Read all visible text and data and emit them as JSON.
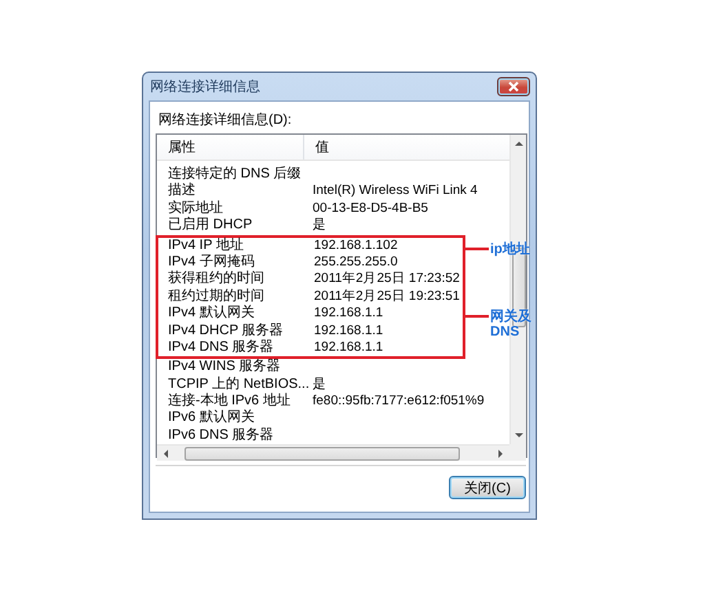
{
  "window": {
    "title": "网络连接详细信息"
  },
  "list_label": "网络连接详细信息(D):",
  "table": {
    "columns": [
      "属性",
      "值"
    ],
    "sections": [
      {
        "highlighted": false,
        "rows": [
          {
            "property": "连接特定的 DNS 后缀"
          },
          {
            "property": "描述",
            "value": "Intel(R) Wireless WiFi Link 4"
          },
          {
            "property": "实际地址",
            "value": "00-13-E8-D5-4B-B5"
          },
          {
            "property": "已启用 DHCP",
            "value": "是"
          }
        ]
      },
      {
        "highlighted": true,
        "rows": [
          {
            "property": "IPv4 IP 地址",
            "value": "192.168.1.102",
            "callout": "ip地址"
          },
          {
            "property": "IPv4 子网掩码",
            "value": "255.255.255.0"
          },
          {
            "property": "获得租约的时间",
            "value": "2011年2月25日 17:23:52"
          },
          {
            "property": "租约过期的时间",
            "value": "2011年2月25日 19:23:51"
          },
          {
            "property": "IPv4 默认网关",
            "value": "192.168.1.1",
            "callout": "网关及DNS"
          },
          {
            "property": "IPv4 DHCP 服务器",
            "value": "192.168.1.1"
          },
          {
            "property": "IPv4 DNS 服务器",
            "value": "192.168.1.1"
          }
        ]
      },
      {
        "highlighted": false,
        "rows": [
          {
            "property": "IPv4 WINS 服务器"
          },
          {
            "property": "TCPIP 上的 NetBIOS...",
            "value": "是"
          },
          {
            "property": "连接-本地 IPv6 地址",
            "value": "fe80::95fb:7177:e612:f051%9"
          },
          {
            "property": "IPv6 默认网关"
          },
          {
            "property": "IPv6 DNS 服务器"
          }
        ]
      }
    ]
  },
  "buttons": [
    {
      "label": "关闭(C)"
    }
  ]
}
